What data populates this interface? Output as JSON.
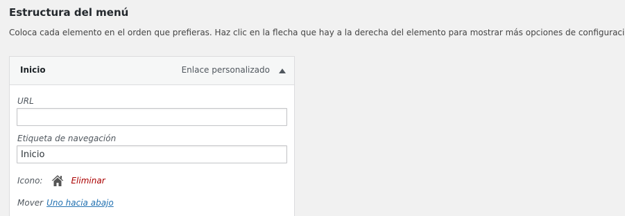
{
  "section": {
    "title": "Estructura del menú",
    "description": "Coloca cada elemento en el orden que prefieras. Haz clic en la flecha que hay a la derecha del elemento para mostrar más opciones de configuración."
  },
  "menu_item": {
    "title": "Inicio",
    "type": "Enlace personalizado",
    "arrow_icon": "arrow-up-icon",
    "url": {
      "label": "URL",
      "value": ""
    },
    "nav_label": {
      "label": "Etiqueta de navegación",
      "value": "Inicio"
    },
    "icon": {
      "label": "Icono:",
      "icon_name": "home-icon",
      "delete_label": "Eliminar"
    },
    "move": {
      "label": "Mover",
      "link": "Uno hacia abajo"
    }
  },
  "colors": {
    "delete": "#aa0000",
    "link": "#2271b1"
  }
}
